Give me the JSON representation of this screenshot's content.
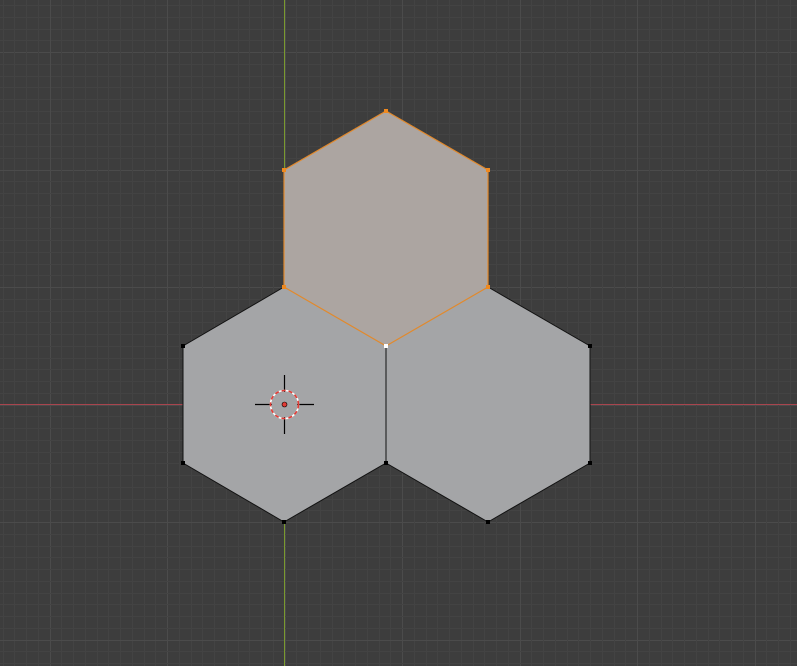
{
  "viewport": {
    "mode": "edit-mode",
    "view": "top-orthographic",
    "background_color": "#3d3d3d"
  },
  "colors": {
    "grid_minor": "#434343",
    "grid_major": "#4b4b4b",
    "x_axis": "#a8454e",
    "y_axis": "#7a9a2e",
    "face_unselected": "#a4a5a7",
    "face_selected": "#aca5a1",
    "edge_unselected": "#111111",
    "edge_selected": "#e2892b",
    "vertex_unselected": "#000000",
    "vertex_selected": "#f0891e",
    "vertex_active": "#ffffff",
    "cursor_ring_red": "#e23b35",
    "cursor_ring_white": "#ffffff",
    "cursor_crosshair": "#000000"
  },
  "mesh": {
    "faces": [
      {
        "id": "hex-top",
        "selected": true
      },
      {
        "id": "hex-left",
        "selected": false
      },
      {
        "id": "hex-right",
        "selected": false
      }
    ]
  },
  "icons": {
    "cursor": "3d-cursor-icon"
  }
}
